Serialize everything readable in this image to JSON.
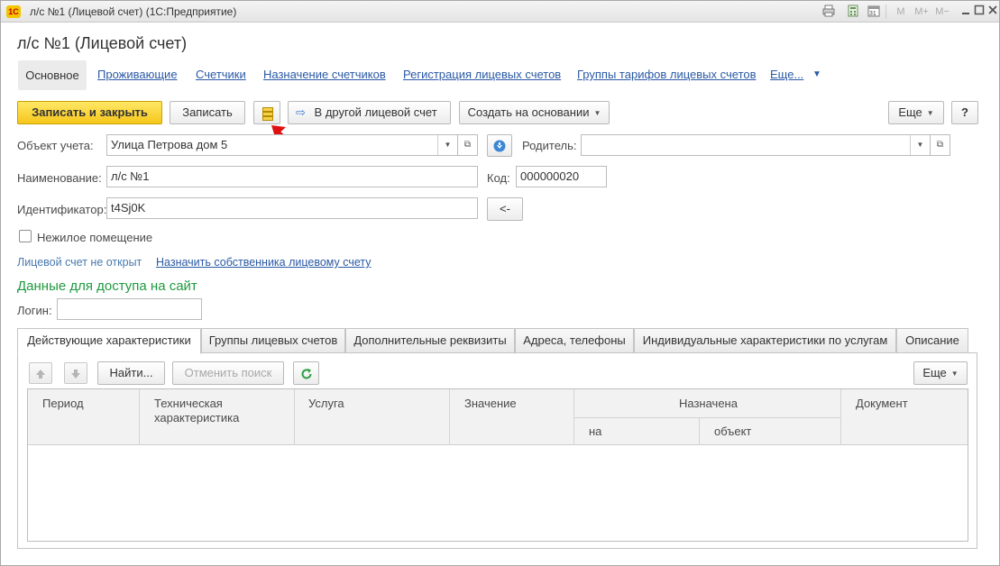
{
  "window": {
    "app_badge": "1С",
    "title": "л/с №1 (Лицевой счет) (1С:Предприятие)",
    "titlebar_icons": [
      "print-icon",
      "calculator-icon",
      "calendar-icon",
      "memory-m-icon",
      "memory-plus-icon",
      "memory-minus-icon",
      "minimize-icon",
      "maximize-icon",
      "close-icon"
    ],
    "memory_labels": {
      "m": "M",
      "mplus": "M+",
      "mminus": "M−"
    },
    "calendar_day": "31"
  },
  "form": {
    "title": "л/с №1 (Лицевой счет)"
  },
  "nav": {
    "main": "Основное",
    "links": [
      "Проживающие",
      "Счетчики",
      "Назначение счетчиков",
      "Регистрация лицевых счетов",
      "Группы тарифов лицевых счетов"
    ],
    "more": "Еще..."
  },
  "toolbar": {
    "save_close": "Записать и закрыть",
    "save": "Записать",
    "to_other_account": "В другой лицевой счет",
    "create_based_on": "Создать на основании",
    "more": "Еще",
    "help": "?"
  },
  "fields": {
    "object_label": "Объект учета:",
    "object_value": "Улица Петрова дом 5",
    "parent_label": "Родитель:",
    "parent_value": "",
    "name_label": "Наименование:",
    "name_value": "л/с №1",
    "code_label": "Код:",
    "code_value": "000000020",
    "id_label": "Идентификатор:",
    "id_value": "t4Sj0K",
    "id_button": "<-",
    "nonresidential_label": "Нежилое помещение",
    "nonresidential_checked": false,
    "account_status": "Лицевой счет не открыт",
    "assign_owner_link": "Назначить собственника лицевому счету"
  },
  "site_access": {
    "title": "Данные для доступа на сайт",
    "login_label": "Логин:",
    "login_value": ""
  },
  "tabs": [
    "Действующие характеристики",
    "Группы лицевых счетов",
    "Дополнительные реквизиты",
    "Адреса, телефоны",
    "Индивидуальные характеристики по услугам",
    "Описание"
  ],
  "panel_toolbar": {
    "find": "Найти...",
    "cancel_search": "Отменить поиск",
    "more": "Еще"
  },
  "table": {
    "columns": {
      "period": "Период",
      "tech": "Техническая характеристика",
      "service": "Услуга",
      "value": "Значение",
      "assigned": "Назначена",
      "assigned_on": "на",
      "assigned_object": "объект",
      "document": "Документ"
    },
    "rows": []
  },
  "colors": {
    "primary_button": "#f6c61a",
    "link": "#2a59a5",
    "section_title": "#1e9a3e",
    "annotation_arrow": "#e01010"
  }
}
